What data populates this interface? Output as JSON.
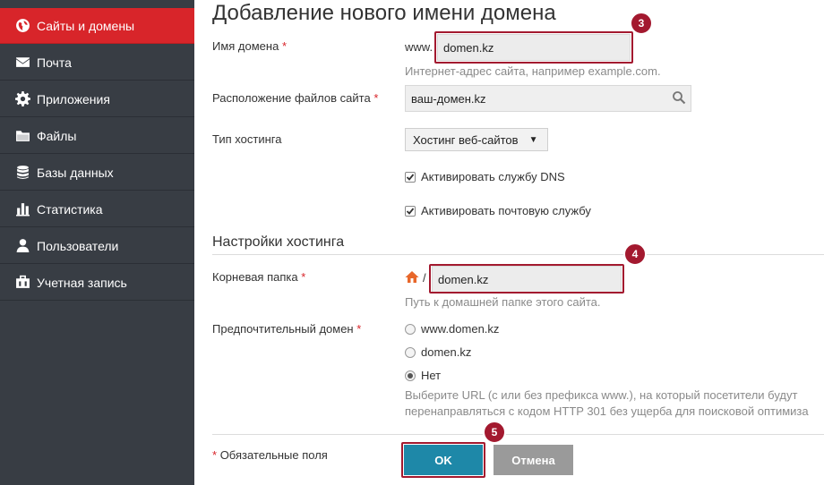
{
  "sidebar": {
    "items": [
      {
        "label": "Сайты и домены",
        "icon": "globe-icon",
        "active": true
      },
      {
        "label": "Почта",
        "icon": "envelope-icon"
      },
      {
        "label": "Приложения",
        "icon": "gear-icon"
      },
      {
        "label": "Файлы",
        "icon": "folder-icon"
      },
      {
        "label": "Базы данных",
        "icon": "database-icon"
      },
      {
        "label": "Статистика",
        "icon": "bar-chart-icon"
      },
      {
        "label": "Пользователи",
        "icon": "user-icon"
      },
      {
        "label": "Учетная запись",
        "icon": "briefcase-icon"
      }
    ]
  },
  "page": {
    "title": "Добавление нового имени домена"
  },
  "form": {
    "domain": {
      "label": "Имя домена",
      "required_mark": "*",
      "prefix": "www.",
      "value": "domen.kz",
      "hint": "Интернет-адрес сайта, например example.com.",
      "badge": "3"
    },
    "location": {
      "label": "Расположение файлов сайта",
      "required_mark": "*",
      "value": "ваш-домен.kz"
    },
    "hosting_type": {
      "label": "Тип хостинга",
      "selected": "Хостинг веб-сайтов",
      "arrow": "▼"
    },
    "dns": {
      "label": "Активировать службу DNS",
      "checked": true
    },
    "mail": {
      "label": "Активировать почтовую службу",
      "checked": true
    }
  },
  "hosting_settings": {
    "title": "Настройки хостинга",
    "root_folder": {
      "label": "Корневая папка",
      "required_mark": "*",
      "separator": "/",
      "value": "domen.kz",
      "hint": "Путь к домашней папке этого сайта.",
      "badge": "4"
    },
    "preferred_domain": {
      "label": "Предпочтительный домен",
      "required_mark": "*",
      "options": [
        "www.domen.kz",
        "domen.kz",
        "Нет"
      ],
      "selected_index": 2,
      "hint_line1": "Выберите URL (с или без префикса www.), на который посетители будут",
      "hint_line2": "перенаправляться с кодом HTTP 301 без ущерба для поисковой оптимиза"
    }
  },
  "footer": {
    "required_note_mark": "*",
    "required_note": "Обязательные поля",
    "ok_label": "OK",
    "cancel_label": "Отмена",
    "badge": "5"
  },
  "colors": {
    "sidebar_bg": "#383d44",
    "active_item": "#d8252a",
    "highlight": "#a3192f",
    "ok_button": "#1e88a8",
    "cancel_button": "#9a9a9a"
  }
}
